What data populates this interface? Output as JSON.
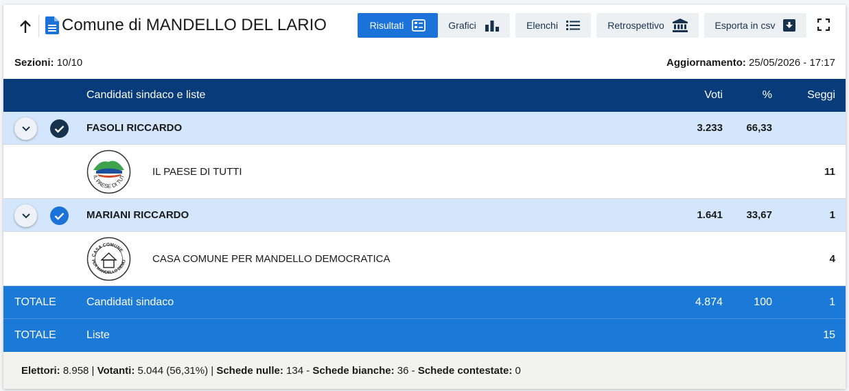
{
  "header": {
    "title": "Comune di MANDELLO DEL LARIO",
    "buttons": {
      "risultati": "Risultati",
      "grafici": "Grafici",
      "elenchi": "Elenchi",
      "retrospettivo": "Retrospettivo",
      "esporta": "Esporta in csv"
    }
  },
  "info": {
    "sezioni_label": "Sezioni:",
    "sezioni_value": "10/10",
    "aggiornamento_label": "Aggiornamento:",
    "aggiornamento_value": "25/05/2026 - 17:17"
  },
  "table": {
    "headers": {
      "name": "Candidati sindaco e liste",
      "voti": "Voti",
      "pct": "%",
      "seggi": "Seggi"
    },
    "candidates": [
      {
        "name": "FASOLI RICCARDO",
        "voti": "3.233",
        "pct": "66,33",
        "seggi": "",
        "list": {
          "name": "IL PAESE DI TUTTI",
          "seggi": "11",
          "logo_text": "IL PAESE DI TUTTI"
        }
      },
      {
        "name": "MARIANI RICCARDO",
        "voti": "1.641",
        "pct": "33,67",
        "seggi": "1",
        "list": {
          "name": "CASA COMUNE PER MANDELLO DEMOCRATICA",
          "seggi": "4",
          "logo_text_top": "CASA COMUNE",
          "logo_text_bottom": "PER MANDELLO DEMOCRATICA"
        }
      }
    ],
    "totals": [
      {
        "label": "TOTALE",
        "name": "Candidati sindaco",
        "voti": "4.874",
        "pct": "100",
        "seggi": "1"
      },
      {
        "label": "TOTALE",
        "name": "Liste",
        "voti": "",
        "pct": "",
        "seggi": "15"
      }
    ]
  },
  "footer": {
    "elettori_label": "Elettori:",
    "elettori_value": "8.958",
    "votanti_label": "Votanti:",
    "votanti_value": "5.044 (56,31%)",
    "nulle_label": "Schede nulle:",
    "nulle_value": "134",
    "bianche_label": "Schede bianche:",
    "bianche_value": "36",
    "contestate_label": "Schede contestate:",
    "contestate_value": "0"
  },
  "colors": {
    "header_bg": "#073b7a",
    "accent": "#1b72d8",
    "candidate_row": "#d4e6fb",
    "total_row": "#1b7ad8"
  },
  "icons": [
    "arrow-up-icon",
    "document-icon",
    "results-list-icon",
    "bar-chart-icon",
    "list-icon",
    "museum-icon",
    "download-icon",
    "fullscreen-icon",
    "chevron-down-icon",
    "check-circle-icon"
  ]
}
